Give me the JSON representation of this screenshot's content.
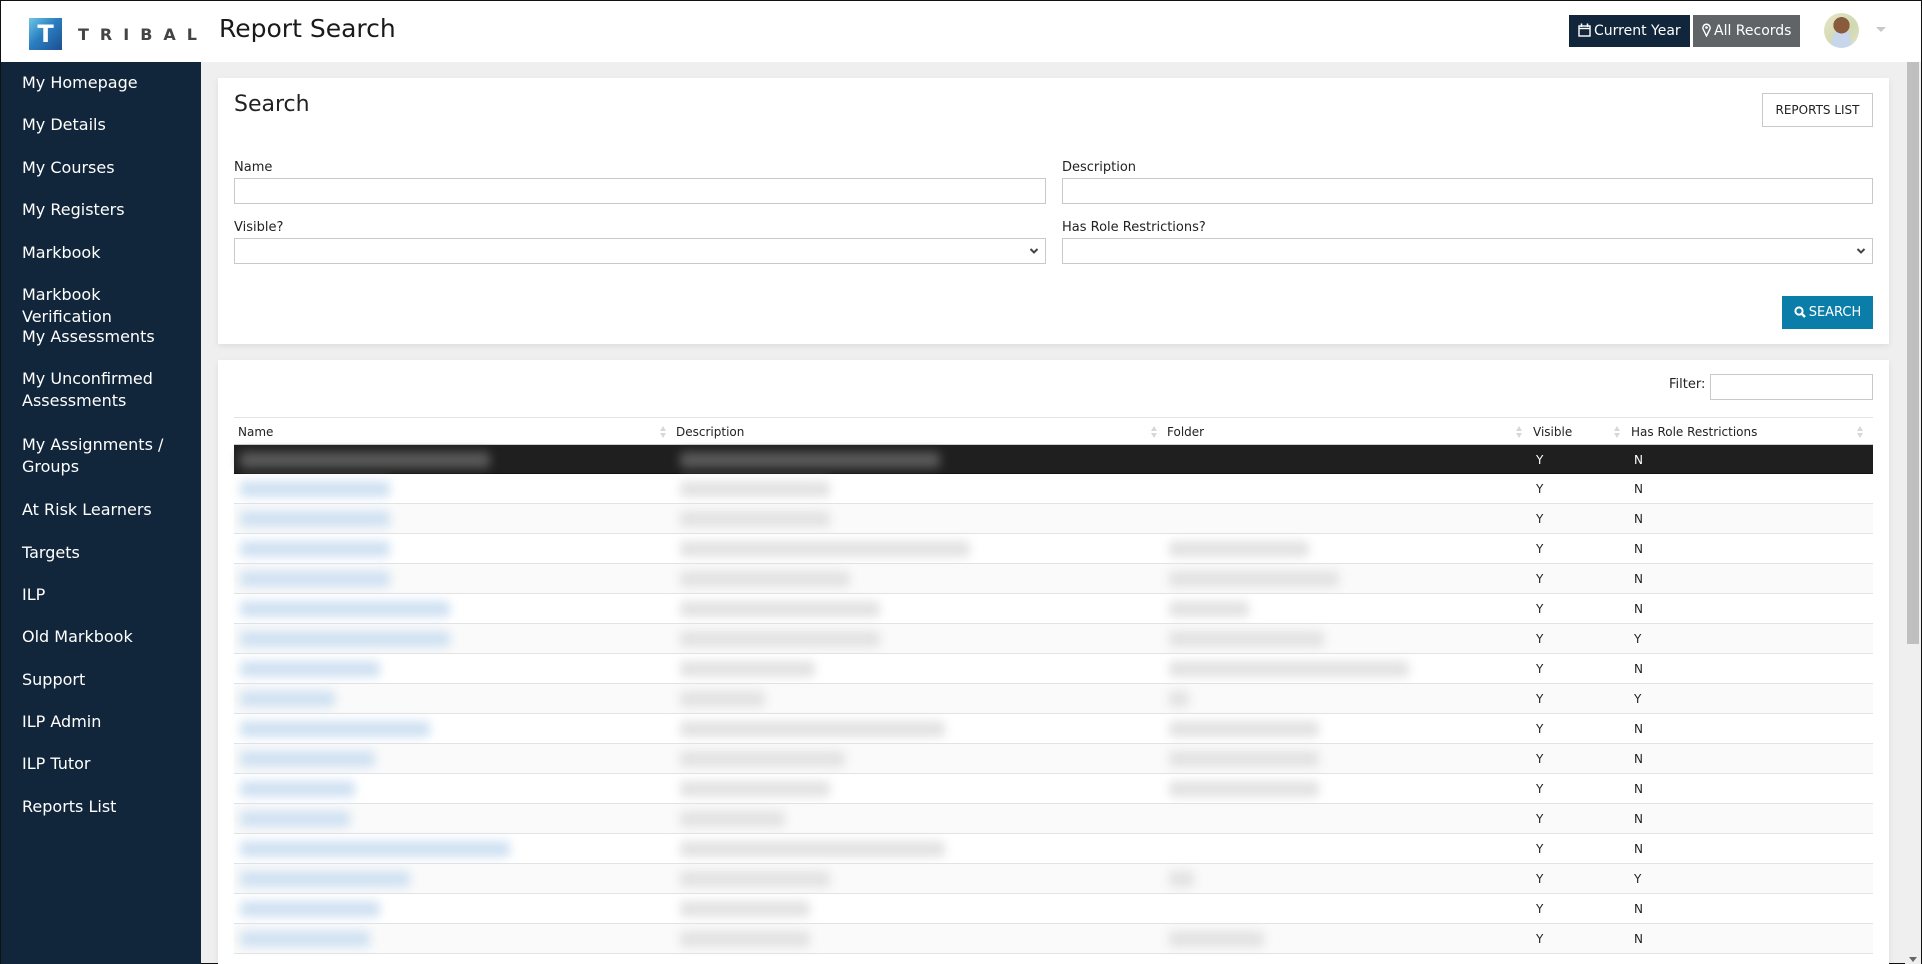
{
  "app": {
    "brand": "TRIBAL",
    "brand_mark": "T",
    "page_title": "Report Search"
  },
  "topbar": {
    "current_year_label": "Current Year",
    "current_year_icon": "calendar-icon",
    "all_records_label": "All Records",
    "all_records_icon": "map-marker-icon",
    "avatar": "user-avatar",
    "colors": {
      "current_year_bg": "#12263b",
      "all_records_bg": "#616466"
    }
  },
  "sidebar": {
    "bg_color": "#12263b",
    "items": [
      {
        "label": "My Homepage"
      },
      {
        "label": "My Details"
      },
      {
        "label": "My Courses"
      },
      {
        "label": "My Registers"
      },
      {
        "label": "Markbook"
      },
      {
        "label": "Markbook Verification"
      },
      {
        "label": "My Assessments"
      },
      {
        "label": "My Unconfirmed Assessments"
      },
      {
        "label": "My Assignments / Groups"
      },
      {
        "label": "At Risk Learners"
      },
      {
        "label": "Targets"
      },
      {
        "label": "ILP"
      },
      {
        "label": "Old Markbook"
      },
      {
        "label": "Support"
      },
      {
        "label": "ILP Admin"
      },
      {
        "label": "ILP Tutor"
      },
      {
        "label": "Reports List"
      }
    ]
  },
  "search": {
    "title": "Search",
    "reports_list_button": "REPORTS LIST",
    "fields": {
      "name": {
        "label": "Name",
        "value": ""
      },
      "description": {
        "label": "Description",
        "value": ""
      },
      "visible": {
        "label": "Visible?",
        "selected": ""
      },
      "role_restrictions": {
        "label": "Has Role Restrictions?",
        "selected": ""
      }
    },
    "search_button": "SEARCH",
    "search_button_color": "#0a7ea8"
  },
  "results": {
    "filter_label": "Filter:",
    "filter_value": "",
    "columns": [
      "Name",
      "Description",
      "Folder",
      "Visible",
      "Has Role Restrictions"
    ],
    "rows": [
      {
        "name": "[redacted]",
        "description": "[redacted]",
        "folder": "",
        "visible": "Y",
        "role": "N",
        "selected": true
      },
      {
        "name": "[redacted]",
        "description": "[redacted]",
        "folder": "",
        "visible": "Y",
        "role": "N"
      },
      {
        "name": "[redacted]",
        "description": "[redacted]",
        "folder": "",
        "visible": "Y",
        "role": "N"
      },
      {
        "name": "[redacted]",
        "description": "[redacted]",
        "folder": "[redacted]",
        "visible": "Y",
        "role": "N"
      },
      {
        "name": "[redacted]",
        "description": "[redacted]",
        "folder": "[redacted]",
        "visible": "Y",
        "role": "N"
      },
      {
        "name": "[redacted]",
        "description": "[redacted]",
        "folder": "[redacted]",
        "visible": "Y",
        "role": "N"
      },
      {
        "name": "[redacted]",
        "description": "[redacted]",
        "folder": "[redacted]",
        "visible": "Y",
        "role": "Y"
      },
      {
        "name": "[redacted]",
        "description": "[redacted]",
        "folder": "[redacted]",
        "visible": "Y",
        "role": "N"
      },
      {
        "name": "[redacted]",
        "description": "[redacted]",
        "folder": "[redacted]",
        "visible": "Y",
        "role": "Y"
      },
      {
        "name": "[redacted]",
        "description": "[redacted]",
        "folder": "[redacted]",
        "visible": "Y",
        "role": "N"
      },
      {
        "name": "[redacted]",
        "description": "[redacted]",
        "folder": "[redacted]",
        "visible": "Y",
        "role": "N"
      },
      {
        "name": "[redacted]",
        "description": "[redacted]",
        "folder": "[redacted]",
        "visible": "Y",
        "role": "N"
      },
      {
        "name": "[redacted]",
        "description": "[redacted]",
        "folder": "",
        "visible": "Y",
        "role": "N"
      },
      {
        "name": "[redacted]",
        "description": "[redacted]",
        "folder": "",
        "visible": "Y",
        "role": "N"
      },
      {
        "name": "[redacted]",
        "description": "[redacted]",
        "folder": "[redacted]",
        "visible": "Y",
        "role": "Y"
      },
      {
        "name": "[redacted]",
        "description": "[redacted]",
        "folder": "",
        "visible": "Y",
        "role": "N"
      },
      {
        "name": "[redacted]",
        "description": "[redacted]",
        "folder": "[redacted]",
        "visible": "Y",
        "role": "N"
      }
    ]
  }
}
